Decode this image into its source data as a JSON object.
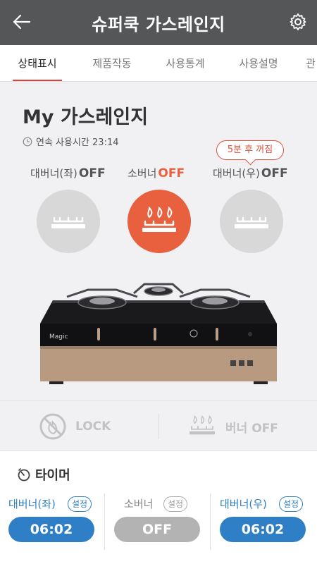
{
  "appbar": {
    "title": "슈퍼쿡 가스레인지"
  },
  "tabs": [
    {
      "label": "상태표시",
      "active": true
    },
    {
      "label": "제품작동",
      "active": false
    },
    {
      "label": "사용통계",
      "active": false
    },
    {
      "label": "사용설명",
      "active": false
    },
    {
      "label": "관",
      "active": false
    }
  ],
  "status": {
    "heading": "My 가스레인지",
    "usage_text": "연속 사용시간 23:14",
    "timer_bubble": "5분 후 꺼짐",
    "burners": [
      {
        "name": "대버너(좌)",
        "state": "OFF"
      },
      {
        "name": "소버너",
        "state": "OFF"
      },
      {
        "name": "대버너(우)",
        "state": "OFF"
      }
    ]
  },
  "stove": {
    "brand": "Magic"
  },
  "controls": {
    "lock_label": "LOCK",
    "burner_off_label": "버너 OFF"
  },
  "timer": {
    "title": "타이머",
    "set_label": "설정",
    "columns": [
      {
        "name": "대버너(좌)",
        "value": "06:02"
      },
      {
        "name": "소버너",
        "value": "OFF"
      },
      {
        "name": "대버너(우)",
        "value": "06:02"
      }
    ]
  },
  "colors": {
    "appbar": "#555657",
    "accent_red": "#e0403a",
    "burner_on": "#e8603e",
    "timer_blue": "#2f7fc6",
    "timer_gray": "#b3b3b3"
  }
}
